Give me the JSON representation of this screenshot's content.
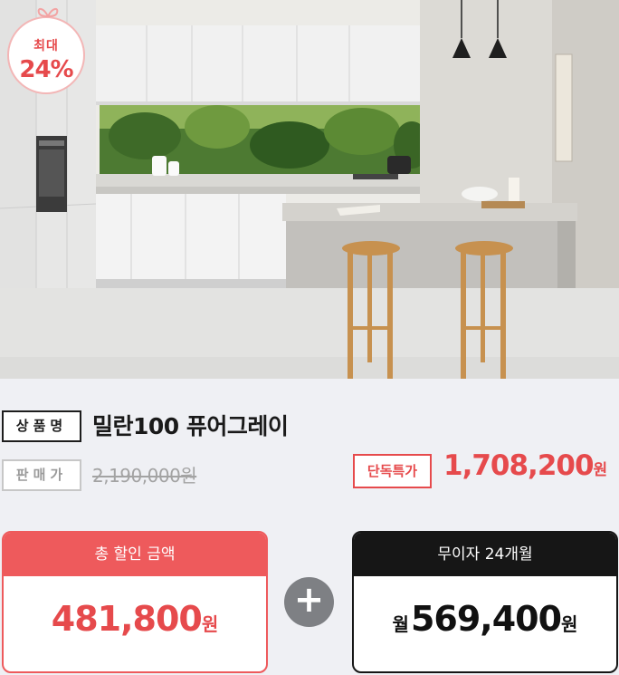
{
  "badge": {
    "top_label": "최대",
    "rate": "24%"
  },
  "product": {
    "name_tag": "상품명",
    "name": "밀란100 퓨어그레이",
    "price_tag": "판매가",
    "original_price": "2,190,000원",
    "special_tag": "단독특가",
    "special_price": "1,708,200",
    "special_unit": "원"
  },
  "discount_box": {
    "title": "총 할인 금액",
    "amount": "481,800",
    "unit": "원"
  },
  "plus_sign": "+",
  "installment_box": {
    "title": "무이자 24개월",
    "prefix": "월",
    "amount": "569,400",
    "unit": "원"
  },
  "colors": {
    "accent_red": "#e64a4c",
    "dark": "#161616",
    "gray_plus": "#7e8084",
    "background": "#eff0f4"
  },
  "icons": {
    "badge_bow": "gift-bow-icon",
    "plus": "plus-icon"
  }
}
